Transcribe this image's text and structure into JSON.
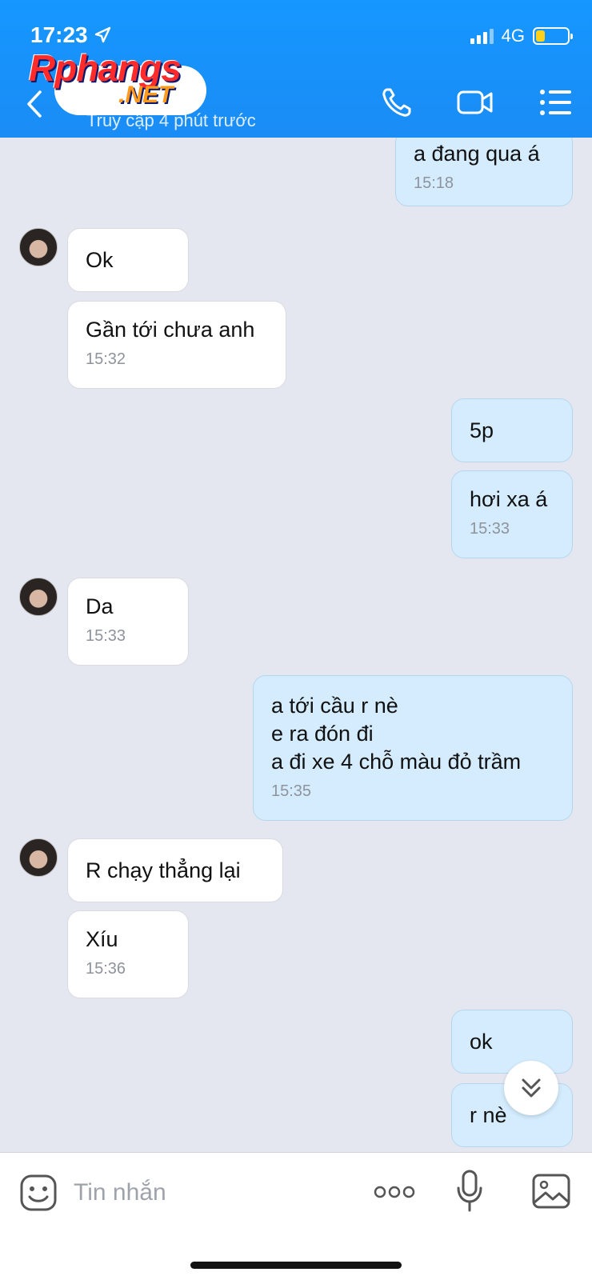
{
  "status_bar": {
    "time": "17:23",
    "network": "4G"
  },
  "header": {
    "watermark_main": "Rphangs",
    "watermark_sub": ".NET",
    "last_seen": "Truy cập 4 phút trước"
  },
  "messages": [
    {
      "side": "out",
      "text": "a đang qua á",
      "time": "15:18"
    },
    {
      "side": "in",
      "text": "Ok",
      "time": ""
    },
    {
      "side": "in",
      "text": "Gần tới chưa anh",
      "time": "15:32"
    },
    {
      "side": "out",
      "text": "5p",
      "time": ""
    },
    {
      "side": "out",
      "text": "hơi xa á",
      "time": "15:33"
    },
    {
      "side": "in",
      "text": "Da",
      "time": "15:33"
    },
    {
      "side": "out",
      "text": "a tới cầu r nè\ne ra đón đi\na đi xe 4 chỗ màu đỏ trầm",
      "time": "15:35"
    },
    {
      "side": "in",
      "text": "R chạy thẳng lại",
      "time": ""
    },
    {
      "side": "in",
      "text": "Xíu",
      "time": "15:36"
    },
    {
      "side": "out",
      "text": "ok",
      "time": ""
    },
    {
      "side": "out",
      "text": "r nè",
      "time": ""
    }
  ],
  "input": {
    "placeholder": "Tin nhắn"
  },
  "colors": {
    "header": "#1597ff",
    "outgoing_bubble": "#d4ecfd",
    "incoming_bubble": "#ffffff",
    "background": "#e4e7f0"
  }
}
